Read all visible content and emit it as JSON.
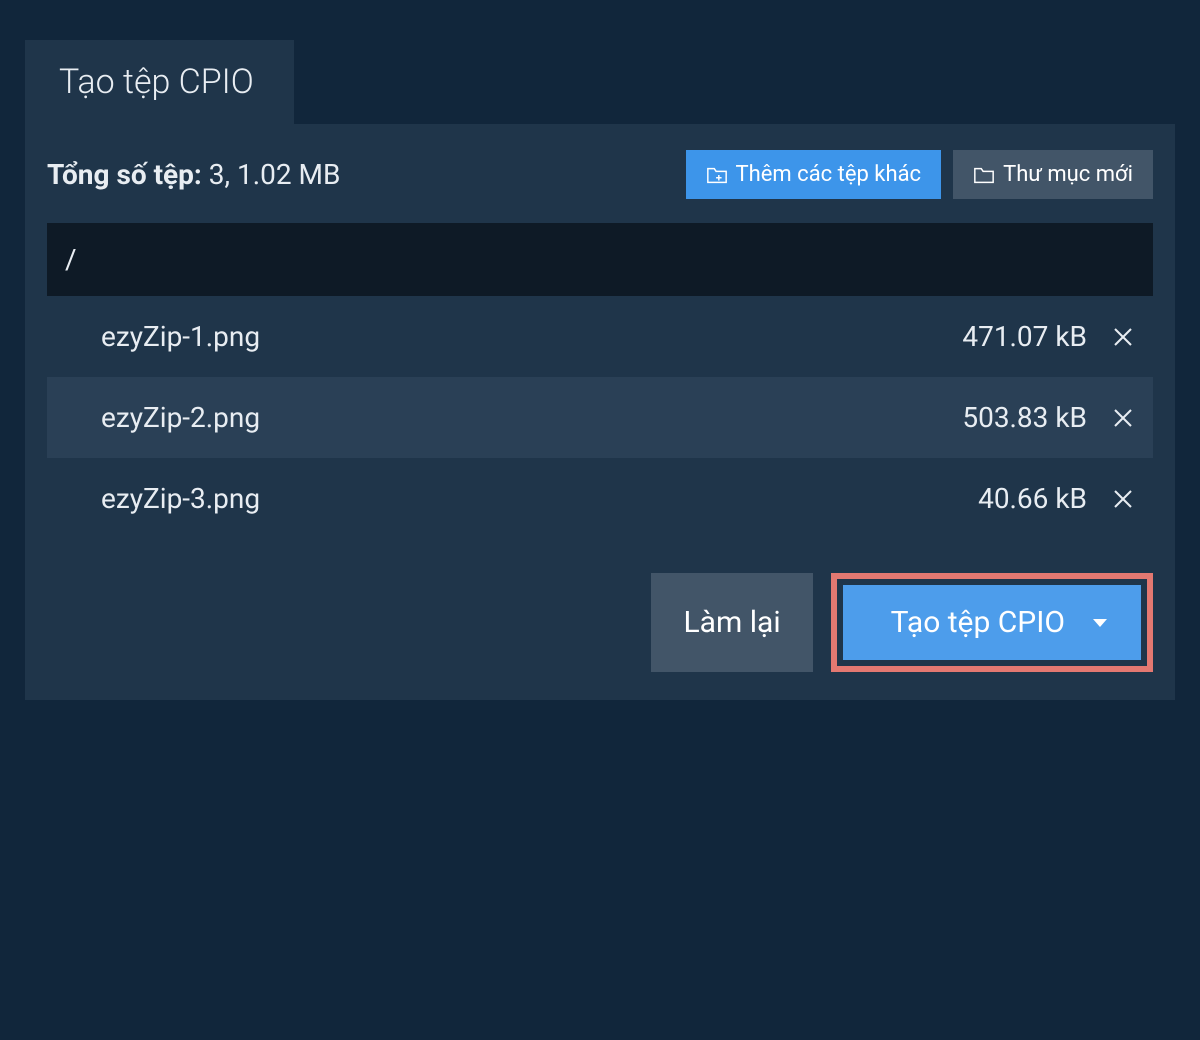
{
  "tab": {
    "title": "Tạo tệp CPIO"
  },
  "summary": {
    "label": "Tổng số tệp:",
    "value": "3, 1.02 MB"
  },
  "buttons": {
    "add_files": "Thêm các tệp khác",
    "new_folder": "Thư mục mới",
    "reset": "Làm lại",
    "create": "Tạo tệp CPIO"
  },
  "path": "/",
  "files": [
    {
      "name": "ezyZip-1.png",
      "size": "471.07 kB"
    },
    {
      "name": "ezyZip-2.png",
      "size": "503.83 kB"
    },
    {
      "name": "ezyZip-3.png",
      "size": "40.66 kB"
    }
  ]
}
